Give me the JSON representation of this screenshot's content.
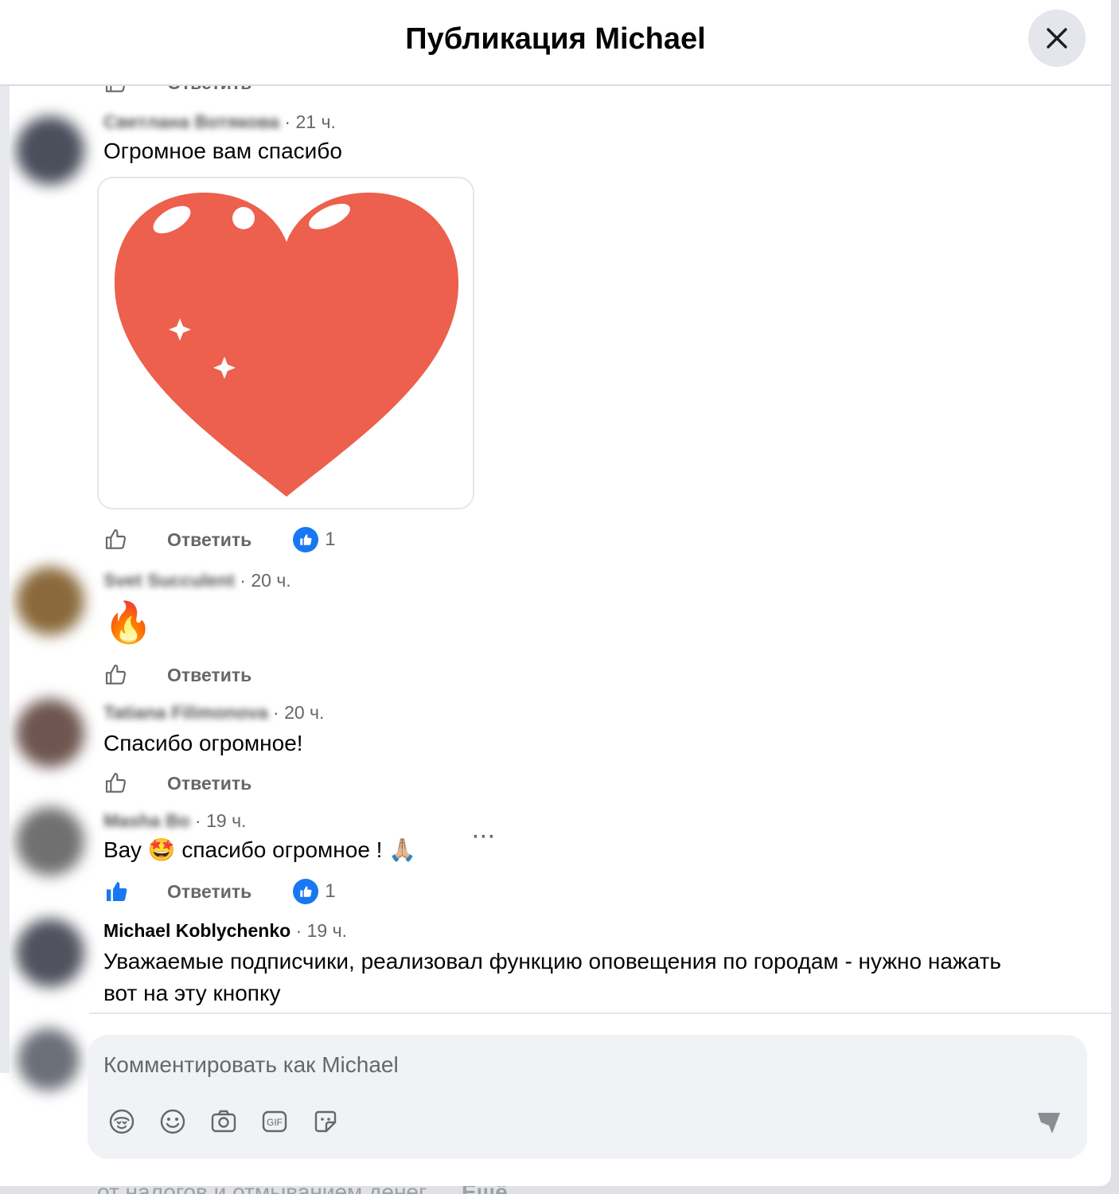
{
  "header": {
    "title": "Публикация Michael"
  },
  "comments": [
    {
      "author": "Светлана Вотякова",
      "time": "21 ч.",
      "text": "Огромное вам спасибо",
      "reply_label": "Ответить",
      "reaction_count": "1"
    },
    {
      "author": "Svet Succulent",
      "time": "20 ч.",
      "emoji": "🔥",
      "reply_label": "Ответить"
    },
    {
      "author": "Tatiana Filimonova",
      "time": "20 ч.",
      "text": "Спасибо огромное!",
      "reply_label": "Ответить"
    },
    {
      "author": "Masha Bo",
      "time": "19 ч.",
      "text": "Вау 🤩 спасибо огромное ! 🙏🏼",
      "reply_label": "Ответить",
      "reaction_count": "1",
      "more": "···"
    },
    {
      "author": "Michael Koblychenko",
      "time": "19 ч.",
      "text": "Уважаемые подписчики, реализовал функцию оповещения по городам - нужно нажать вот на эту кнопку"
    }
  ],
  "top_partial": {
    "reply_label": "Ответить"
  },
  "composer": {
    "placeholder": "Комментировать как Michael"
  },
  "background": {
    "text": "от налогов и отмыванием денег",
    "more": "Ещё"
  },
  "icons": [
    "close-icon",
    "like-icon",
    "like-filled-icon",
    "avatar-icon",
    "emoji-icon",
    "camera-icon",
    "gif-icon",
    "sticker-icon",
    "send-icon"
  ],
  "colors": {
    "accent": "#1877f2",
    "heart": "#ec604d",
    "secondary_text": "#65676b",
    "composer_bg": "#f0f2f5"
  }
}
